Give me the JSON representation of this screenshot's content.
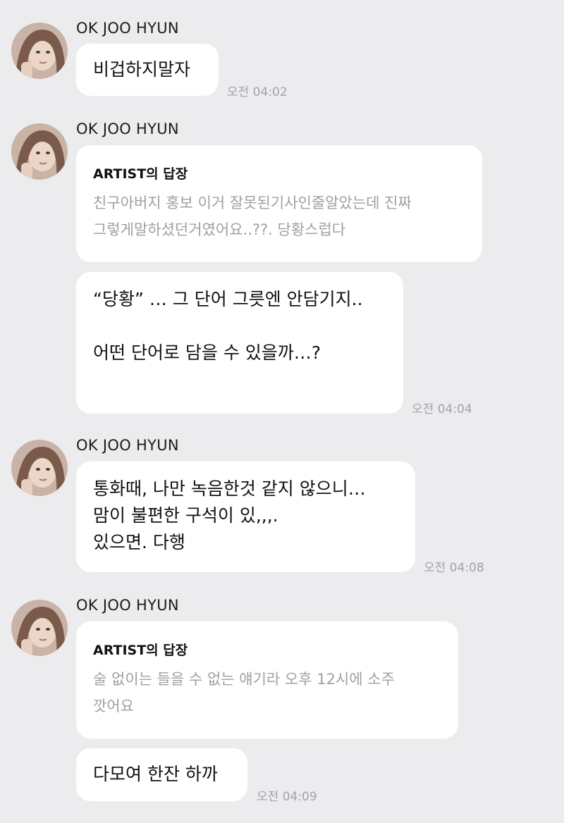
{
  "chat": {
    "sender": "OK JOO HYUN",
    "groups": [
      {
        "sender": "OK JOO HYUN",
        "messages": [
          {
            "text": "비겁하지말자",
            "time": "오전 04:02"
          }
        ]
      },
      {
        "sender": "OK JOO HYUN",
        "reply": {
          "title": "ARTIST의 답장",
          "body": "친구아버지 홍보 이거 잘못된기사인줄알았는데 진짜\n그렇게말하셨던거였어요..??. 당황스럽다"
        },
        "messages": [
          {
            "text": "“당황” … 그 단어 그릇엔 안담기지..\n\n어떤 단어로 담을 수 있을까…?",
            "time": "오전 04:04"
          }
        ]
      },
      {
        "sender": "OK JOO HYUN",
        "messages": [
          {
            "text": "통화때, 나만 녹음한것 같지 않으니…\n맘이 불편한 구석이 있,,,.\n있으면.  다행",
            "time": "오전 04:08"
          }
        ]
      },
      {
        "sender": "OK JOO HYUN",
        "reply": {
          "title": "ARTIST의 답장",
          "body": "술 없이는 들을 수 없는 얘기라 오후 12시에 소주\n깟어요"
        },
        "messages": [
          {
            "text": "다모여 한잔 하까",
            "time": "오전 04:09"
          }
        ]
      }
    ]
  }
}
